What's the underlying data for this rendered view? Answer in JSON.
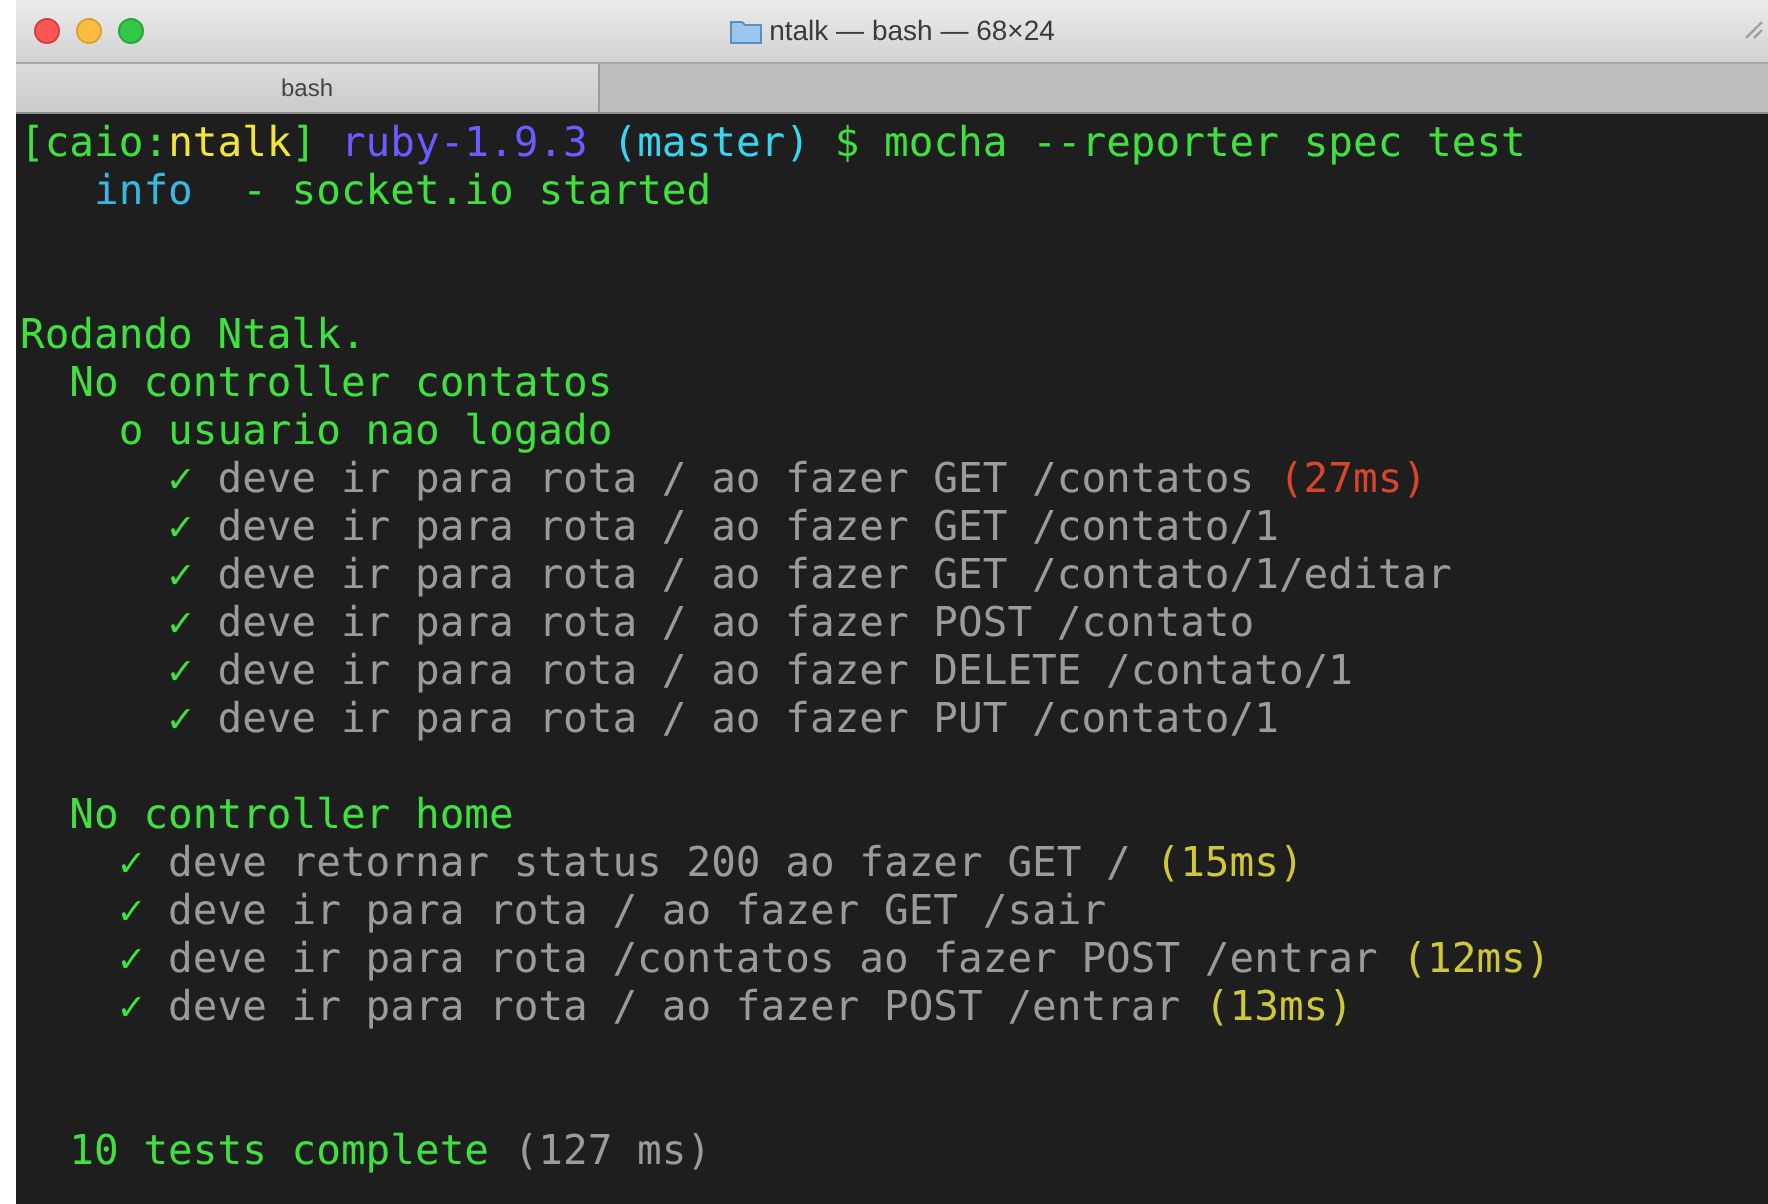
{
  "window": {
    "title": "ntalk — bash — 68×24"
  },
  "tabs": [
    {
      "label": "bash",
      "selected": true
    }
  ],
  "terminal": {
    "lines": [
      {
        "kind": "text",
        "segments": [
          {
            "text": "[caio:",
            "color": "#3fe03f"
          },
          {
            "text": "ntalk",
            "color": "#f2e53a"
          },
          {
            "text": "]",
            "color": "#3fe03f"
          },
          {
            "text": " ruby-1.9.3",
            "color": "#6c5cff"
          },
          {
            "text": " (master)",
            "color": "#38d6ee"
          },
          {
            "text": " $ mocha --reporter spec test",
            "color": "#3fe03f"
          }
        ]
      },
      {
        "kind": "text",
        "segments": [
          {
            "text": "   info",
            "color": "#38b8e0"
          },
          {
            "text": "  - socket.io started",
            "color": "#3fe03f"
          }
        ]
      },
      {
        "kind": "blank"
      },
      {
        "kind": "blank"
      },
      {
        "kind": "text",
        "segments": [
          {
            "text": "Rodando Ntalk.",
            "color": "#3fe03f"
          }
        ]
      },
      {
        "kind": "text",
        "segments": [
          {
            "text": "  No controller contatos",
            "color": "#3fe03f"
          }
        ]
      },
      {
        "kind": "text",
        "segments": [
          {
            "text": "    o usuario nao logado",
            "color": "#3fe03f"
          }
        ]
      },
      {
        "kind": "text",
        "segments": [
          {
            "text": "      ✓",
            "color": "#3fe03f"
          },
          {
            "text": " deve ir para rota / ao fazer GET /contatos",
            "color": "#9b9b9b"
          },
          {
            "text": " (27ms)",
            "color": "#d8452d"
          }
        ]
      },
      {
        "kind": "text",
        "segments": [
          {
            "text": "      ✓",
            "color": "#3fe03f"
          },
          {
            "text": " deve ir para rota / ao fazer GET /contato/1",
            "color": "#9b9b9b"
          }
        ]
      },
      {
        "kind": "text",
        "segments": [
          {
            "text": "      ✓",
            "color": "#3fe03f"
          },
          {
            "text": " deve ir para rota / ao fazer GET /contato/1/editar",
            "color": "#9b9b9b"
          }
        ]
      },
      {
        "kind": "text",
        "segments": [
          {
            "text": "      ✓",
            "color": "#3fe03f"
          },
          {
            "text": " deve ir para rota / ao fazer POST /contato",
            "color": "#9b9b9b"
          }
        ]
      },
      {
        "kind": "text",
        "segments": [
          {
            "text": "      ✓",
            "color": "#3fe03f"
          },
          {
            "text": " deve ir para rota / ao fazer DELETE /contato/1",
            "color": "#9b9b9b"
          }
        ]
      },
      {
        "kind": "text",
        "segments": [
          {
            "text": "      ✓",
            "color": "#3fe03f"
          },
          {
            "text": " deve ir para rota / ao fazer PUT /contato/1",
            "color": "#9b9b9b"
          }
        ]
      },
      {
        "kind": "blank"
      },
      {
        "kind": "text",
        "segments": [
          {
            "text": "  No controller home",
            "color": "#3fe03f"
          }
        ]
      },
      {
        "kind": "text",
        "segments": [
          {
            "text": "    ✓",
            "color": "#3fe03f"
          },
          {
            "text": " deve retornar status 200 ao fazer GET /",
            "color": "#9b9b9b"
          },
          {
            "text": " (15ms)",
            "color": "#cfc63a"
          }
        ]
      },
      {
        "kind": "text",
        "segments": [
          {
            "text": "    ✓",
            "color": "#3fe03f"
          },
          {
            "text": " deve ir para rota / ao fazer GET /sair",
            "color": "#9b9b9b"
          }
        ]
      },
      {
        "kind": "text",
        "segments": [
          {
            "text": "    ✓",
            "color": "#3fe03f"
          },
          {
            "text": " deve ir para rota /contatos ao fazer POST /entrar",
            "color": "#9b9b9b"
          },
          {
            "text": " (12ms)",
            "color": "#cfc63a"
          }
        ]
      },
      {
        "kind": "text",
        "segments": [
          {
            "text": "    ✓",
            "color": "#3fe03f"
          },
          {
            "text": " deve ir para rota / ao fazer POST /entrar",
            "color": "#9b9b9b"
          },
          {
            "text": " (13ms)",
            "color": "#cfc63a"
          }
        ]
      },
      {
        "kind": "blank"
      },
      {
        "kind": "blank"
      },
      {
        "kind": "text",
        "segments": [
          {
            "text": "  10 tests complete",
            "color": "#3fe03f"
          },
          {
            "text": " (127 ms)",
            "color": "#9b9b9b"
          }
        ]
      }
    ]
  }
}
